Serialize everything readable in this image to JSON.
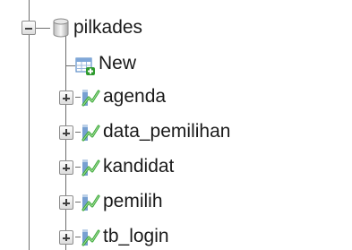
{
  "tree": {
    "database": {
      "label": "pilkades",
      "expanded": true,
      "icon": "database-icon"
    },
    "new_item": {
      "label": "New",
      "icon": "new-table-icon"
    },
    "tables": [
      {
        "label": "agenda",
        "icon": "table-icon",
        "expanded": false
      },
      {
        "label": "data_pemilihan",
        "icon": "table-icon",
        "expanded": false
      },
      {
        "label": "kandidat",
        "icon": "table-icon",
        "expanded": false
      },
      {
        "label": "pemilih",
        "icon": "table-icon",
        "expanded": false
      },
      {
        "label": "tb_login",
        "icon": "table-icon",
        "expanded": false
      }
    ]
  },
  "colors": {
    "connector": "#6f6f6f",
    "text": "#1a1a1a",
    "table_icon_green": "#3aa63a",
    "table_icon_blue": "#5f8fc9",
    "new_badge_green": "#2e9a2e"
  }
}
